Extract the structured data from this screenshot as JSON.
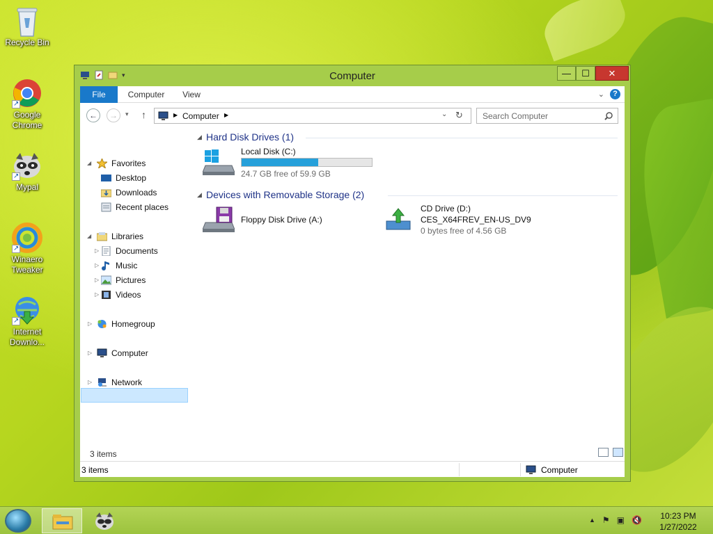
{
  "desktop": {
    "icons": [
      {
        "label": "Recycle Bin"
      },
      {
        "label": "Google Chrome"
      },
      {
        "label": "Mypal"
      },
      {
        "label": "Winaero Tweaker"
      },
      {
        "label": "Internet Downlo..."
      }
    ]
  },
  "window": {
    "title": "Computer",
    "controls": {
      "minimize": "—",
      "maximize": "☐",
      "close": "✕"
    },
    "ribbon": {
      "file": "File",
      "computer": "Computer",
      "view": "View",
      "help": "?"
    },
    "address": {
      "path": "Computer"
    },
    "search": {
      "placeholder": "Search Computer"
    },
    "nav": {
      "favorites": "Favorites",
      "desktop": "Desktop",
      "downloads": "Downloads",
      "recent": "Recent places",
      "libraries": "Libraries",
      "documents": "Documents",
      "music": "Music",
      "pictures": "Pictures",
      "videos": "Videos",
      "homegroup": "Homegroup",
      "computer": "Computer",
      "network": "Network"
    },
    "groups": {
      "hdd": "Hard Disk Drives (1)",
      "removable": "Devices with Removable Storage (2)"
    },
    "drives": {
      "c": {
        "name": "Local Disk (C:)",
        "free": "24.7 GB free of 59.9 GB",
        "used_fraction": 0.59
      },
      "a": {
        "name": "Floppy Disk Drive (A:)"
      },
      "d": {
        "name": "CD Drive (D:)",
        "label": "CES_X64FREV_EN-US_DV9",
        "free": "0 bytes free of 4.56 GB"
      }
    },
    "items_count": "3 items",
    "status": {
      "left": "3 items",
      "right": "Computer"
    }
  },
  "taskbar": {
    "time": "10:23 PM",
    "date": "1/27/2022"
  }
}
